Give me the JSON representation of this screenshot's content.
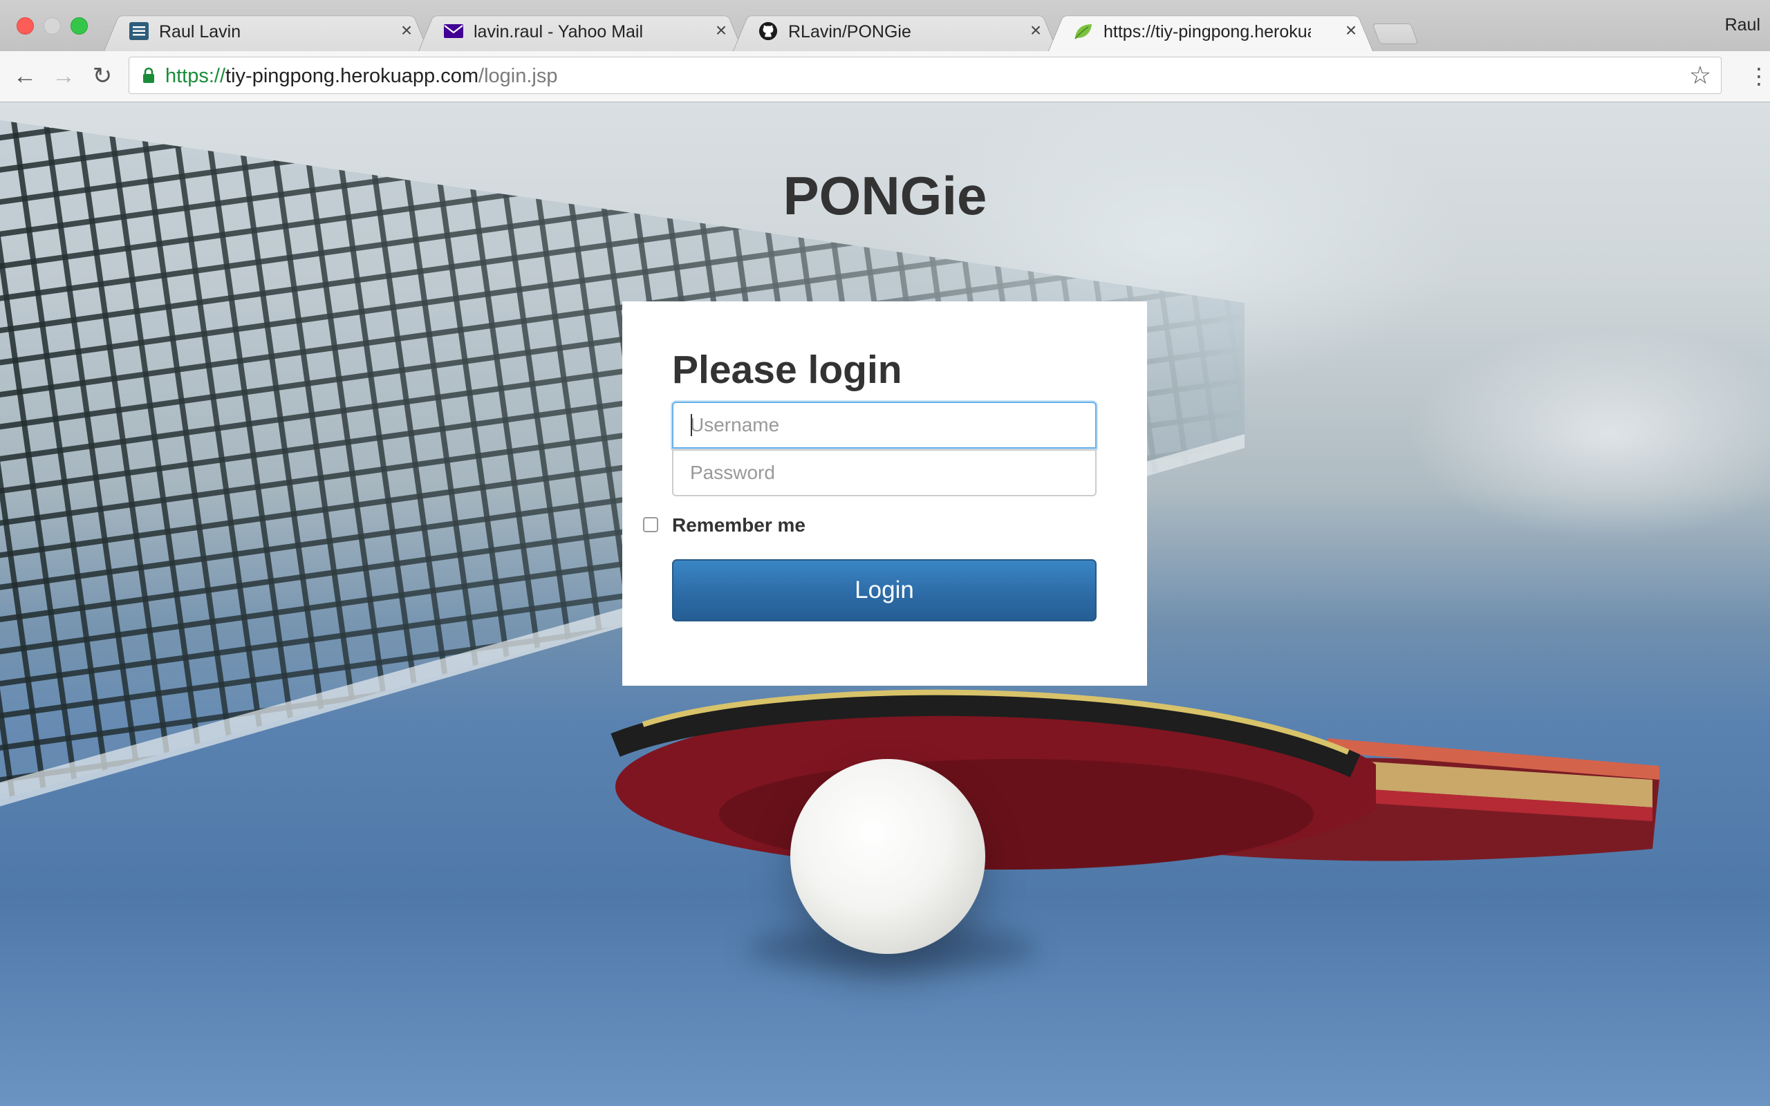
{
  "browser": {
    "tabs": [
      {
        "title": "Raul Lavin",
        "icon": "document-icon",
        "close": "×"
      },
      {
        "title": "lavin.raul - Yahoo Mail",
        "icon": "mail-icon",
        "close": "×"
      },
      {
        "title": "RLavin/PONGie",
        "icon": "github-icon",
        "close": "×"
      },
      {
        "title": "https://tiy-pingpong.herokuapp.com/login.jsp",
        "icon": "leaf-icon",
        "close": "×",
        "active": true
      }
    ],
    "profile_name": "Raul",
    "address": {
      "scheme": "https://",
      "host": "tiy-pingpong.herokuapp.com",
      "path": "/login.jsp"
    },
    "nav": {
      "back": "←",
      "forward": "→",
      "reload": "↻",
      "star": "☆",
      "menu": "⋮"
    }
  },
  "page": {
    "site_title": "PONGie",
    "login": {
      "heading": "Please login",
      "username_placeholder": "Username",
      "password_placeholder": "Password",
      "remember_label": "Remember me",
      "remember_checked": false,
      "submit_label": "Login"
    }
  },
  "colors": {
    "button_primary": "#337ab7",
    "focus_border": "#66afe9",
    "secure_url": "#1a8c3a"
  }
}
